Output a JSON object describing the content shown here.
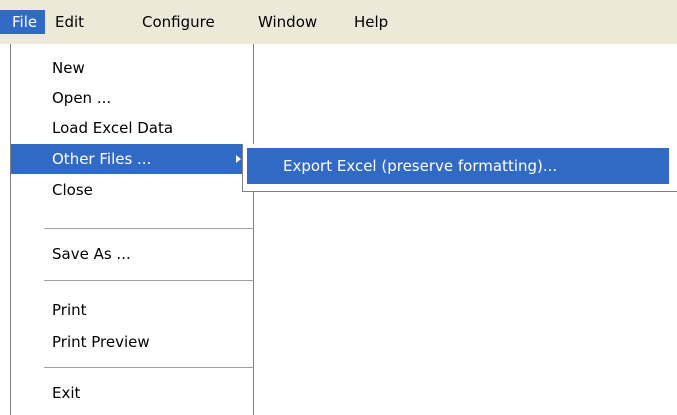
{
  "menubar": {
    "items": [
      "File",
      "Edit",
      "Configure",
      "Window",
      "Help"
    ]
  },
  "file_menu": {
    "new": "New",
    "open": "Open ...",
    "load_excel": "Load Excel Data",
    "other_files": "Other Files ...",
    "close": "Close",
    "save_as": "Save As ...",
    "print": "Print",
    "print_preview": "Print Preview",
    "exit": "Exit"
  },
  "submenu": {
    "export_excel": "Export Excel (preserve formatting)..."
  },
  "colors": {
    "highlight": "#316ac5",
    "menubar_bg": "#ece9d8",
    "separator": "#a0a0a0"
  },
  "icons": {
    "submenu_arrow": "chevron-right-icon"
  }
}
